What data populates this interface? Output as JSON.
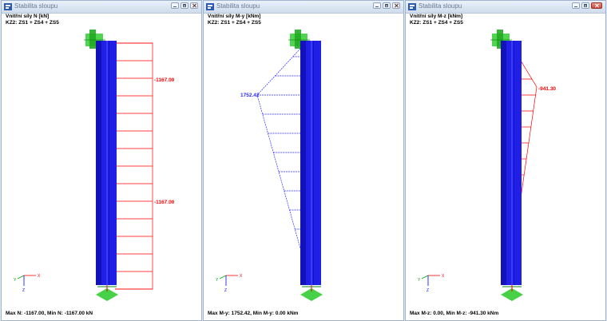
{
  "windows": [
    {
      "title": "Stabilita sloupu",
      "heading1": "Vnitřní síly N [kN]",
      "heading2": "KZ2: ZS1 + ZS4 + ZS5",
      "labels": [
        "-1167.00",
        "-1167.00"
      ],
      "footer": "Max N: -1167.00, Min N: -1167.00 kN",
      "diagram_color": "#ff0000"
    },
    {
      "title": "Stabilita sloupu",
      "heading1": "Vnitřní síly M-y [kNm]",
      "heading2": "KZ2: ZS1 + ZS4 + ZS5",
      "labels": [
        "1752.42"
      ],
      "footer": "Max M-y: 1752.42, Min M-y: 0.00 kNm",
      "diagram_color": "#2a2aff"
    },
    {
      "title": "Stabilita sloupu",
      "heading1": "Vnitřní síly M-z [kNm]",
      "heading2": "KZ2: ZS1 + ZS4 + ZS5",
      "labels": [
        "-941.30"
      ],
      "footer": "Max M-z: 0.00, Min M-z: -941.30 kNm",
      "diagram_color": "#ff0000"
    }
  ],
  "axes": {
    "x": "X",
    "y": "Y",
    "z": "Z"
  },
  "icons": {
    "app": "app-icon",
    "minimize": "minimize-icon",
    "maximize": "maximize-icon",
    "close": "close-icon"
  },
  "colors": {
    "column": "#1f1fe6",
    "support": "#33cc33"
  }
}
